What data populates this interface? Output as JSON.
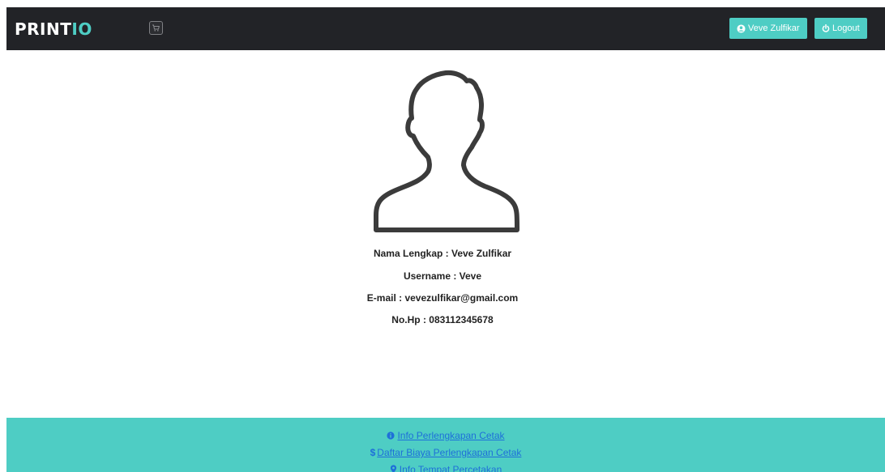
{
  "navbar": {
    "brand_main": "PRINT",
    "brand_accent": "IO",
    "cart_icon": "cart-icon",
    "user_button_label": "Veve Zulfikar",
    "user_icon": "user-circle-icon",
    "logout_button_label": "Logout",
    "logout_icon": "power-icon"
  },
  "profile": {
    "avatar_icon": "user-silhouette-icon",
    "nama": "Nama Lengkap : Veve Zulfikar",
    "username": "Username : Veve",
    "email": "E-mail : vevezulfikar@gmail.com",
    "hp": "No.Hp : 083112345678"
  },
  "footer": {
    "links": [
      {
        "label": "Info Perlengkapan Cetak",
        "icon": "info-icon"
      },
      {
        "label": "Daftar Biaya Perlengkapan Cetak",
        "icon": "dollar-icon",
        "symbol": "$"
      },
      {
        "label": "Info Tempat Percetakan",
        "icon": "map-marker-icon"
      }
    ]
  },
  "colors": {
    "navbar_bg": "#222327",
    "accent": "#4ecdc4",
    "link": "#1e6fd9",
    "text": "#222222"
  }
}
